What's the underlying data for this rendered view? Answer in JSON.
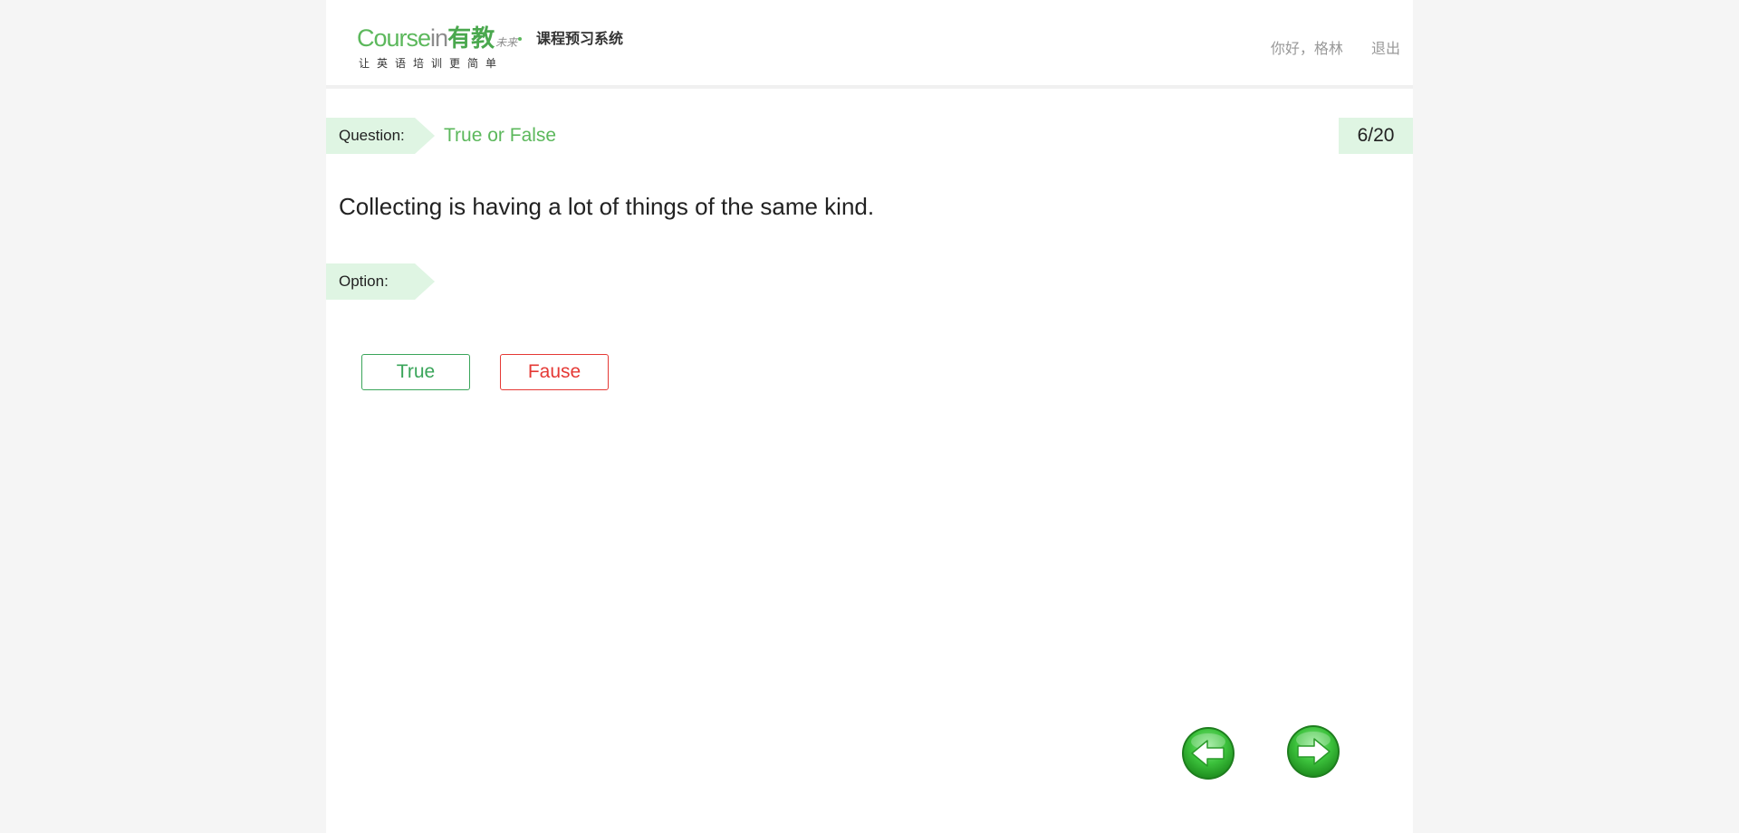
{
  "header": {
    "logo": {
      "course": "Course",
      "in": "in",
      "cn": "有教",
      "small": "未来",
      "system": "课程预习系统",
      "slogan": "让英语培训更简单"
    },
    "greeting": "你好，格林",
    "logout_label": "退出"
  },
  "question": {
    "tag_label": "Question:",
    "type": "True or False",
    "progress": "6/20",
    "text": "Collecting is having a lot of things of the same kind."
  },
  "options": {
    "tag_label": "Option:",
    "true_label": "True",
    "false_label": "Fause"
  },
  "navigation": {
    "prev_icon": "arrow-left-icon",
    "next_icon": "arrow-right-icon"
  },
  "colors": {
    "accent": "#5cb85c",
    "tag_bg": "#dff5e3",
    "true_color": "#3aa55a",
    "false_color": "#e53935"
  }
}
